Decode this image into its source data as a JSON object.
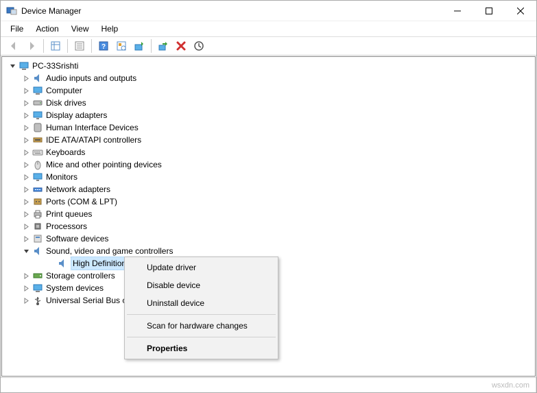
{
  "window": {
    "title": "Device Manager"
  },
  "menu": {
    "file": "File",
    "action": "Action",
    "view": "View",
    "help": "Help"
  },
  "tree": {
    "root": "PC-33Srishti",
    "items": [
      {
        "label": "Audio inputs and outputs",
        "icon": "audio"
      },
      {
        "label": "Computer",
        "icon": "computer"
      },
      {
        "label": "Disk drives",
        "icon": "disk"
      },
      {
        "label": "Display adapters",
        "icon": "display"
      },
      {
        "label": "Human Interface Devices",
        "icon": "hid"
      },
      {
        "label": "IDE ATA/ATAPI controllers",
        "icon": "ide"
      },
      {
        "label": "Keyboards",
        "icon": "keyboard"
      },
      {
        "label": "Mice and other pointing devices",
        "icon": "mouse"
      },
      {
        "label": "Monitors",
        "icon": "monitor"
      },
      {
        "label": "Network adapters",
        "icon": "network"
      },
      {
        "label": "Ports (COM & LPT)",
        "icon": "port"
      },
      {
        "label": "Print queues",
        "icon": "printer"
      },
      {
        "label": "Processors",
        "icon": "cpu"
      },
      {
        "label": "Software devices",
        "icon": "software"
      }
    ],
    "expanded": {
      "label": "Sound, video and game controllers",
      "icon": "audio",
      "child": {
        "label": "High Definition A",
        "label_full": "High Definition Audio Device",
        "icon": "audio"
      }
    },
    "after": [
      {
        "label": "Storage controllers",
        "icon": "storage"
      },
      {
        "label": "System devices",
        "icon": "system"
      },
      {
        "label": "Universal Serial Bus c",
        "icon": "usb"
      }
    ]
  },
  "context_menu": {
    "update": "Update driver",
    "disable": "Disable device",
    "uninstall": "Uninstall device",
    "scan": "Scan for hardware changes",
    "properties": "Properties"
  },
  "watermark": "wsxdn.com"
}
